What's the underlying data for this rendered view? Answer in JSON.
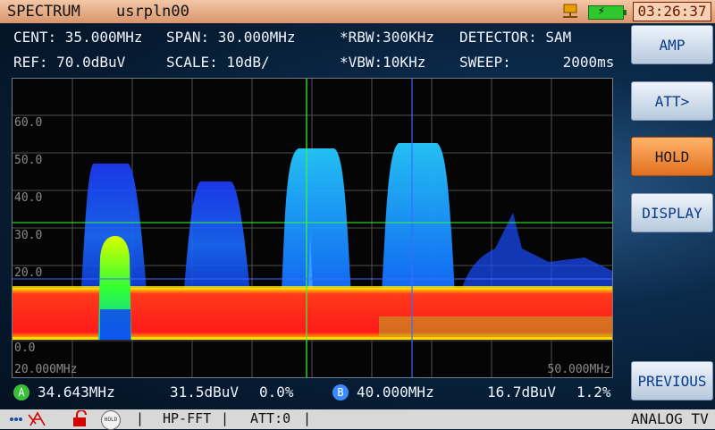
{
  "titlebar": {
    "mode": "SPECTRUM",
    "user": "usrpln00",
    "clock": "03:26:37"
  },
  "params": {
    "cent": "CENT: 35.000MHz",
    "span": "SPAN:  30.000MHz",
    "rbw": "*RBW:300KHz",
    "detector": "DETECTOR: SAM",
    "ref": "REF:  70.0dBuV",
    "scale": "SCALE: 10dB/",
    "vbw": "*VBW:10KHz",
    "sweep": "SWEEP:      2000ms"
  },
  "plot": {
    "y_ticks": [
      "60.0",
      "50.0",
      "40.0",
      "30.0",
      "20.0",
      "0.0"
    ],
    "x_start": "20.000MHz",
    "x_end": "50.000MHz"
  },
  "buttons": {
    "amp": "AMP",
    "att": "ATT>",
    "hold": "HOLD",
    "display": "DISPLAY",
    "previous": "PREVIOUS"
  },
  "markers": {
    "a_label": "A",
    "a_freq": "34.643MHz",
    "a_level": "31.5dBuV",
    "a_pct": "0.0%",
    "b_label": "B",
    "b_freq": "40.000MHz",
    "b_level": "16.7dBuV",
    "b_pct": "1.2%"
  },
  "status": {
    "hold_icon": "HOLD",
    "fft": "HP-FFT",
    "att": "ATT:0",
    "mode": "ANALOG TV"
  },
  "colors": {
    "accent": "#e2701f",
    "spectrum_noise": "#ff1a1a",
    "spectrum_signal": "#1a5cff",
    "grid": "#555555"
  },
  "icons": [
    "network-icon",
    "battery-icon",
    "signal-icon",
    "lock-icon",
    "hold-icon"
  ]
}
